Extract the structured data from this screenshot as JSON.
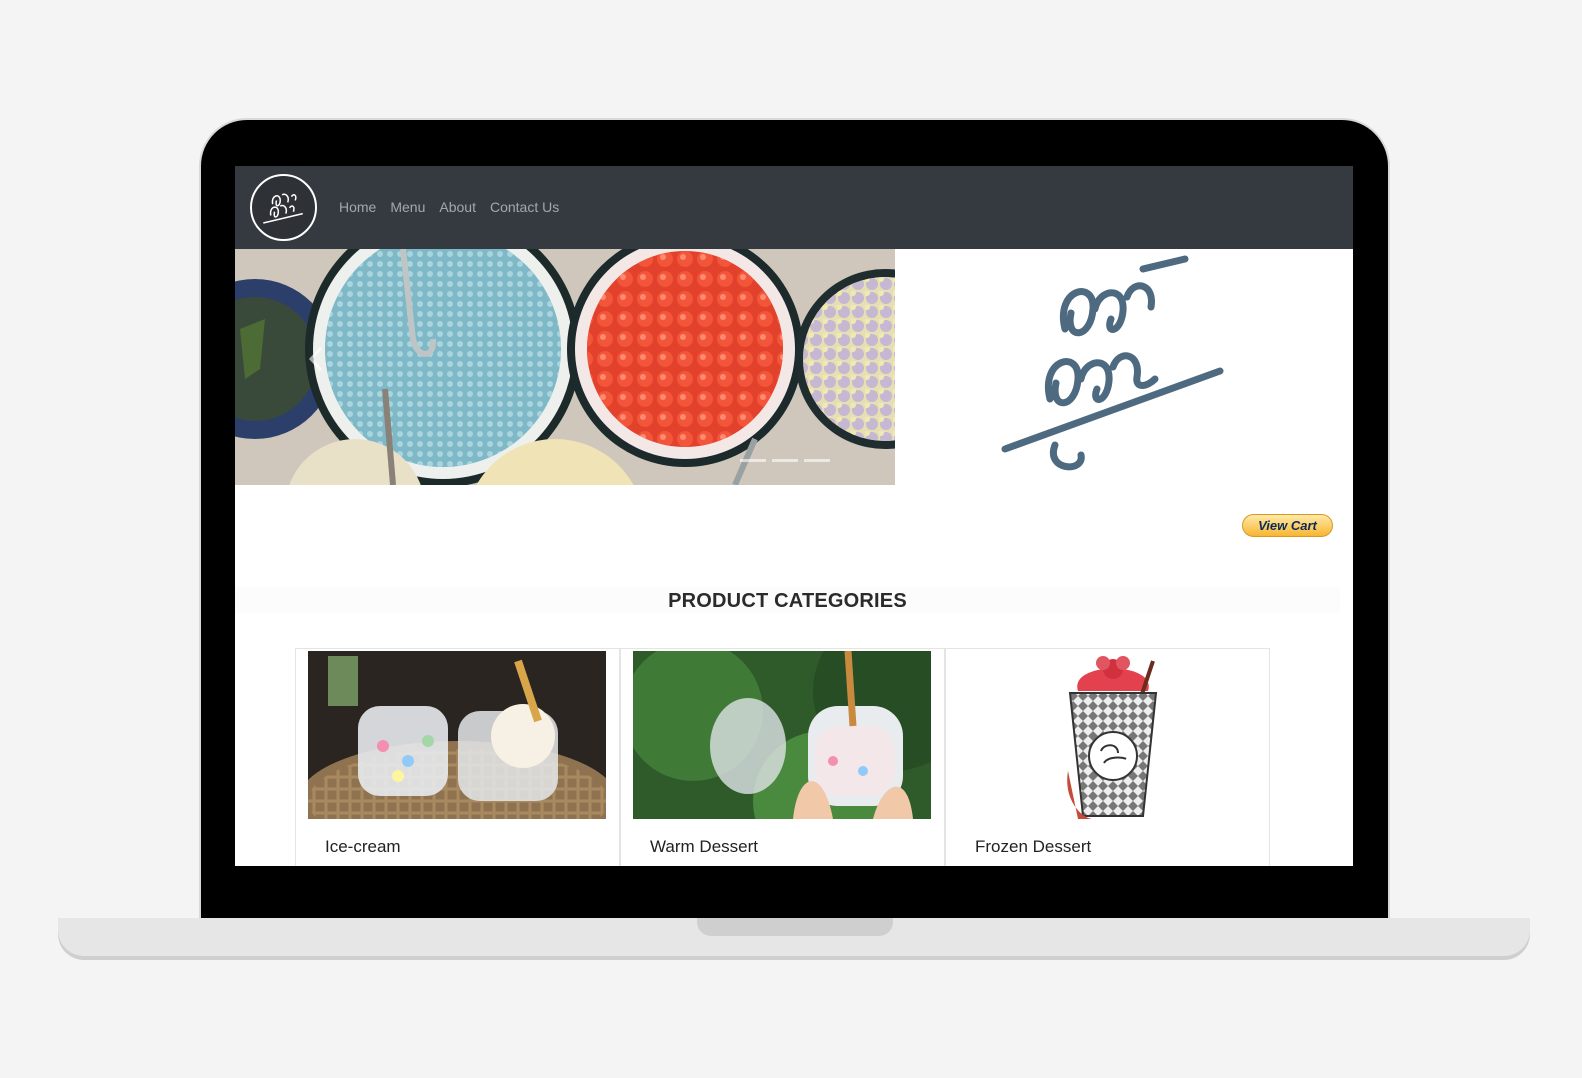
{
  "nav": {
    "links": [
      {
        "label": "Home"
      },
      {
        "label": "Menu"
      },
      {
        "label": "About"
      },
      {
        "label": "Contact Us"
      }
    ]
  },
  "cart": {
    "label": "View Cart"
  },
  "categories": {
    "title": "PRODUCT CATEGORIES",
    "items": [
      {
        "label": "Ice-cream"
      },
      {
        "label": "Warm Dessert"
      },
      {
        "label": "Frozen Dessert"
      }
    ]
  },
  "colors": {
    "navbar": "#343a40",
    "logo_ink": "#4e6a80",
    "cart_gold": "#f7b632"
  }
}
